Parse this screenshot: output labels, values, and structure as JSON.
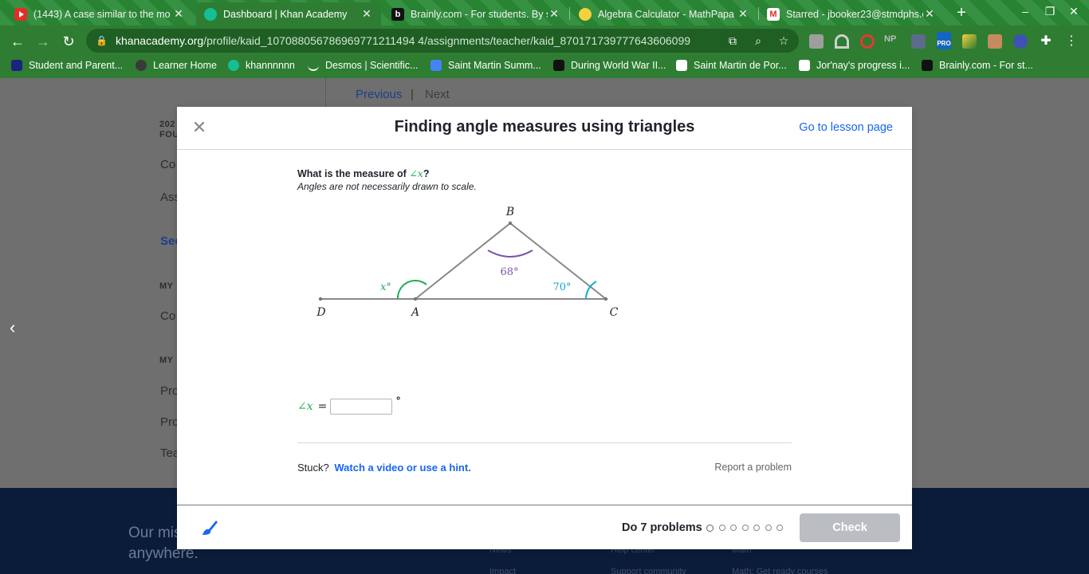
{
  "browser": {
    "tabs": [
      {
        "title": "(1443) A case similar to the mo",
        "favicon": "youtube-icon"
      },
      {
        "title": "Dashboard | Khan Academy",
        "favicon": "khan-academy-icon"
      },
      {
        "title": "Brainly.com - For students. By s",
        "favicon": "brainly-icon"
      },
      {
        "title": "Algebra Calculator - MathPapa",
        "favicon": "mathpapa-icon"
      },
      {
        "title": "Starred - jbooker23@stmdphs.o",
        "favicon": "gmail-icon"
      }
    ],
    "close_glyph": "✕",
    "new_tab_glyph": "+",
    "url_host": "khanacademy.org",
    "url_path": "/profile/kaid_107088056786969771211494 4/assignments/teacher/kaid_870171739777643606099",
    "bookmarks": [
      "Student and Parent...",
      "Learner Home",
      "khannnnnn",
      "Desmos | Scientific...",
      "Saint Martin Summ...",
      "During World War II...",
      "Saint Martin de Por...",
      "Jor'nay's progress i...",
      "Brainly.com - For st..."
    ],
    "ext_pro_label": "PRO",
    "ext_np_label": "NP"
  },
  "background_page": {
    "previous": "Previous",
    "separator": "|",
    "next": "Next",
    "sidebar_fragments": [
      "202",
      "FOU",
      "Co",
      "Ass",
      "See",
      "MY",
      "Co",
      "MY",
      "Pro",
      "Pro",
      "Tea"
    ],
    "mission": "Our mis... education to anyone, anywhere.",
    "footer_links": [
      "News",
      "Help center",
      "Math",
      "Impact",
      "Support community",
      "Math: Get ready courses"
    ]
  },
  "modal": {
    "title": "Finding angle measures using triangles",
    "lesson_link": "Go to lesson page",
    "question_prefix": "What is the measure of",
    "question_angle": "∠x",
    "question_suffix": "?",
    "note": "Angles are not necessarily drawn to scale.",
    "diagram": {
      "label_B": "B",
      "label_D": "D",
      "label_A": "A",
      "label_C": "C",
      "angle_B": "68°",
      "angle_C": "70°",
      "angle_x": "x°",
      "colors": {
        "angle_B": "#7854ab",
        "angle_C": "#11accd",
        "angle_x": "#1fab54",
        "lines": "#888888"
      }
    },
    "answer_label": "∠x",
    "answer_equals": "=",
    "answer_value": "",
    "answer_unit": "°",
    "stuck_text": "Stuck?",
    "hint_link": "Watch a video or use a hint.",
    "report": "Report a problem",
    "do_problems": "Do 7 problems",
    "problem_count": 7,
    "check_button": "Check"
  }
}
